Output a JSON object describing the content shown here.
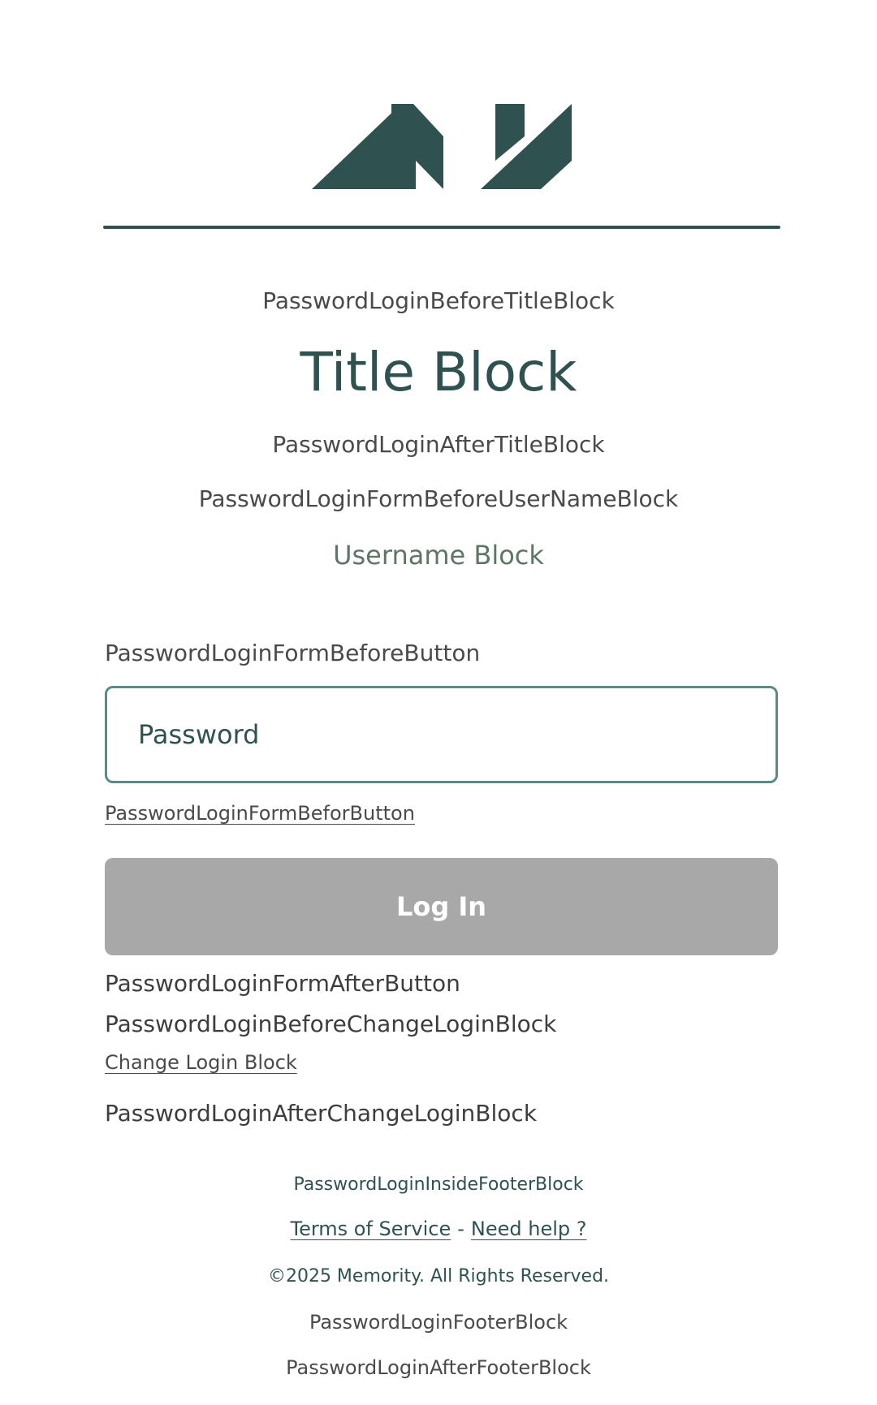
{
  "brand": {
    "logo": "my-logo-icon",
    "color": "#2f5251"
  },
  "blocks": {
    "before_title": "PasswordLoginBeforeTitleBlock",
    "title": "Title Block",
    "after_title": "PasswordLoginAfterTitleBlock",
    "before_username": "PasswordLoginFormBeforeUserNameBlock",
    "username": "Username Block",
    "form_before_button": "PasswordLoginFormBeforeButton",
    "form_befor_button_link": "PasswordLoginFormBeforButton",
    "form_after_button": "PasswordLoginFormAfterButton",
    "before_change_login": "PasswordLoginBeforeChangeLoginBlock",
    "change_login_link": "Change Login Block",
    "after_change_login": "PasswordLoginAfterChangeLoginBlock"
  },
  "form": {
    "password_placeholder": "Password",
    "password_value": "",
    "login_label": "Log In",
    "login_button_color": "#a8a8a8"
  },
  "footer": {
    "inside": "PasswordLoginInsideFooterBlock",
    "terms_label": "Terms of Service",
    "separator": "-",
    "help_label": "Need help ?",
    "copyright": "©2025 Memority. All Rights Reserved.",
    "footer_block": "PasswordLoginFooterBlock",
    "after_footer": "PasswordLoginAfterFooterBlock"
  }
}
